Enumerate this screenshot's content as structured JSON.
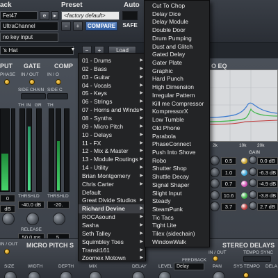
{
  "header": {
    "track_label": "ack",
    "preset_label": "Preset",
    "auto_label": "Auto",
    "track_field": "Fet47",
    "track_suffix": "e",
    "channel_field": "UltraChannel",
    "preset_field": "<factory default>",
    "minus": "−",
    "plus": "+",
    "compare": "COMPARE",
    "safe": "SAFE",
    "key_input": "no key input"
  },
  "preset_row": {
    "name": "'s Hat",
    "minus": "−",
    "plus": "+",
    "load": "Load"
  },
  "sections": {
    "input": "PUT",
    "gate": "GATE",
    "comp": "COMP",
    "eq": "O EQ",
    "phase": "PHASE",
    "in_out_gate": "IN / OUT",
    "in_out_comp": "IN / O",
    "side_chain": "SIDE CHAIN",
    "side_chain2": "SIDE C",
    "th": "TH",
    "in": "IN",
    "gr": "GR",
    "thrshld": "THRSHLD",
    "thrshld2": "THRSHLD",
    "release": "RELEASE",
    "gate_thrshld_value": "-40.0 dB",
    "comp_thrshld_value": "-20.",
    "release_value": "50.0 ms",
    "comp_release_value": "5.",
    "left_value_1": "0",
    "left_value_2": "dB",
    "eq_freq_label": "2k",
    "eq_freq_label2": "10k",
    "eq_freq_label3": "20k",
    "gain": "GAIN"
  },
  "eq_rows": [
    {
      "freq": "0.5",
      "gain": "0.0 dB",
      "color": "#c9a227"
    },
    {
      "freq": "1.0",
      "gain": "-6.3 dB",
      "color": "#3aa4d6"
    },
    {
      "freq": "0.7",
      "gain": "-4.9 dB",
      "color": "#d24fb5"
    },
    {
      "freq": "10.6",
      "gain": "-3.8 dB",
      "color": "#3fb54a"
    },
    {
      "freq": "3.7",
      "gain": "2.7 dB",
      "color": "#c03a3a"
    }
  ],
  "bottom": {
    "micro_pitch": "MICRO PITCH S",
    "in_out": "IN / OUT",
    "size": "SIZE",
    "width": "WIDTH",
    "depth": "DEPTH",
    "mix": "MIX",
    "delay": "DELAY",
    "level": "LEVEL",
    "feedback": "FEEDBACK",
    "delay_type": "Delay",
    "pan": "PAN",
    "sys_tempo": "SYS TEMPO",
    "stereo_delays": "STEREO DELAYS",
    "in_out2": "IN / OUT",
    "tempo_sync": "TEMPO SYNC",
    "dela": "DELA"
  },
  "menu_categories": [
    {
      "label": "01 - Drums",
      "submenu": true
    },
    {
      "label": "02 - Bass",
      "submenu": true
    },
    {
      "label": "03 - Guitar",
      "submenu": true
    },
    {
      "label": "04 - Vocals",
      "submenu": true
    },
    {
      "label": "05 - Keys",
      "submenu": true
    },
    {
      "label": "06 - Strings",
      "submenu": true
    },
    {
      "label": "07 - Horns and Winds",
      "submenu": true
    },
    {
      "label": "08 - Synths",
      "submenu": true
    },
    {
      "label": "09 - Micro Pitch",
      "submenu": true
    },
    {
      "label": "10 - Delays",
      "submenu": true
    },
    {
      "label": "11 - FX",
      "submenu": true
    },
    {
      "label": "12 - Mix & Master",
      "submenu": true
    },
    {
      "label": "13 - Module Routings",
      "submenu": true
    },
    {
      "label": "14 - Utility",
      "submenu": true
    },
    {
      "label": "Brian Montgomery",
      "submenu": true
    },
    {
      "label": "Chris Carter",
      "submenu": true
    },
    {
      "label": "Default",
      "submenu": false
    },
    {
      "label": "Great Divide Studios",
      "submenu": true
    },
    {
      "label": "Richard Devine",
      "submenu": true,
      "selected": true
    },
    {
      "label": "ROCAsound",
      "submenu": true
    },
    {
      "label": "Sasha",
      "submenu": true
    },
    {
      "label": "Seth Talley",
      "submenu": true
    },
    {
      "label": "Squimbley Toes",
      "submenu": true
    },
    {
      "label": "Transit161",
      "submenu": true
    },
    {
      "label": "Zoomex Motown",
      "submenu": true
    }
  ],
  "menu_presets": [
    "Cut To Chop",
    "Delay Dice",
    "Delay Module",
    "Double Door",
    "Drum Pumping",
    "Dust and Glitch",
    "Gated Delay",
    "Gater Plate",
    "Graphic",
    "Hard Punch",
    "High Dimension",
    "Irregular Pattern",
    "Kill me Compressor",
    "KompressorX",
    "Low Tumble",
    "Old Phone",
    "Parabola",
    "PhaseConnect",
    "Push Into Shove",
    "Robo",
    "Shutter Shop",
    "Shuttle Decay",
    "Signal Shaper",
    "Slight Input",
    "Steady",
    "SteamPunk",
    "Tic Tacs",
    "Tight Lite",
    "Tilex (sidechain)",
    "WindowWalk"
  ]
}
